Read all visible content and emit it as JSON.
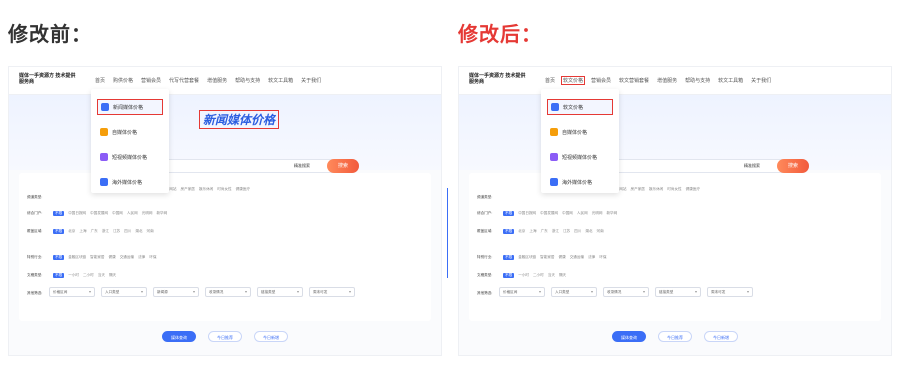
{
  "before": {
    "heading": "修改前：",
    "logo": "媒体一手资源方 技术提供服务商",
    "nav": [
      "首页",
      "购供价格",
      "营销会员",
      "代写代营套餐",
      "增值服务",
      "帮助与支持",
      "软文工具箱",
      "关于我们"
    ],
    "dropdown": [
      {
        "label": "新闻媒体价格",
        "icon": "news-icon",
        "color": "#3b6ef6"
      },
      {
        "label": "自媒体价格",
        "icon": "self-media-icon",
        "color": "#f59e0b"
      },
      {
        "label": "短视频媒体价格",
        "icon": "short-video-icon",
        "color": "#8b5cf6"
      },
      {
        "label": "海外媒体价格",
        "icon": "overseas-icon",
        "color": "#3b6ef6"
      }
    ],
    "hero_title": "新闻媒体价格",
    "search_placeholder": "查询网站",
    "search_filter": "精准搜索",
    "search_button": "搜索",
    "rows": [
      {
        "label": "频道类型:",
        "items": [
          "新闻资讯",
          "财经金融",
          "IT科技",
          "汽车网站",
          "房产家居",
          "娱乐休闲",
          "时尚女性",
          "健康医疗",
          "旅游出行",
          "美食网站"
        ]
      },
      {
        "label": "综合门户:",
        "items": [
          "中国日报网",
          "中国发展网",
          "中国网",
          "人民网",
          "光明网",
          "新华网"
        ]
      },
      {
        "label": "覆盖区域:",
        "items": [
          "北京",
          "上海",
          "广东",
          "浙江",
          "江苏",
          "四川",
          "湖北",
          "河南"
        ]
      },
      {
        "label": "特别行业:",
        "items": [
          "金融区块链",
          "智能家居",
          "健康",
          "交通运输",
          "法律",
          "环保"
        ]
      },
      {
        "label": "文稿类型:",
        "items": [
          "一小时",
          "二小时",
          "当天",
          "隔天"
        ]
      }
    ],
    "selects": [
      "价格区间",
      "入口类型",
      "新闻源",
      "收录情况",
      "链接类型",
      "周末可发"
    ],
    "buttons": [
      "媒体查询",
      "今日推荐",
      "今日新增"
    ]
  },
  "after": {
    "heading": "修改后：",
    "logo": "媒体一手资源方 技术提供服务商",
    "nav": [
      "首页",
      "软文价格",
      "营销会员",
      "软文营销套餐",
      "增值服务",
      "帮助与支持",
      "软文工具箱",
      "关于我们"
    ],
    "dropdown": [
      {
        "label": "软文价格",
        "icon": "news-icon",
        "color": "#3b6ef6"
      },
      {
        "label": "自媒体价格",
        "icon": "self-media-icon",
        "color": "#f59e0b"
      },
      {
        "label": "短视频媒体价格",
        "icon": "short-video-icon",
        "color": "#8b5cf6"
      },
      {
        "label": "海外媒体价格",
        "icon": "overseas-icon",
        "color": "#3b6ef6"
      }
    ],
    "search_placeholder": "查询网站",
    "search_filter": "精准搜索",
    "search_button": "搜索",
    "rows": [
      {
        "label": "频道类型:",
        "items": [
          "新闻资讯",
          "财经金融",
          "IT科技",
          "汽车网站",
          "房产家居",
          "娱乐休闲",
          "时尚女性",
          "健康医疗",
          "旅游出行",
          "美食网站"
        ]
      },
      {
        "label": "综合门户:",
        "items": [
          "中国日报网",
          "中国发展网",
          "中国网",
          "人民网",
          "光明网",
          "新华网"
        ]
      },
      {
        "label": "覆盖区域:",
        "items": [
          "北京",
          "上海",
          "广东",
          "浙江",
          "江苏",
          "四川",
          "湖北",
          "河南"
        ]
      },
      {
        "label": "特别行业:",
        "items": [
          "金融区块链",
          "智能家居",
          "健康",
          "交通运输",
          "法律",
          "环保"
        ]
      },
      {
        "label": "文稿类型:",
        "items": [
          "一小时",
          "二小时",
          "当天",
          "隔天"
        ]
      }
    ],
    "selects": [
      "价格区间",
      "入口类型",
      "收录情况",
      "链接类型",
      "周末可发"
    ],
    "buttons": [
      "媒体查询",
      "今日推荐",
      "今日新增"
    ]
  },
  "accent_red": "#e53935",
  "accent_blue": "#3b6ef6"
}
